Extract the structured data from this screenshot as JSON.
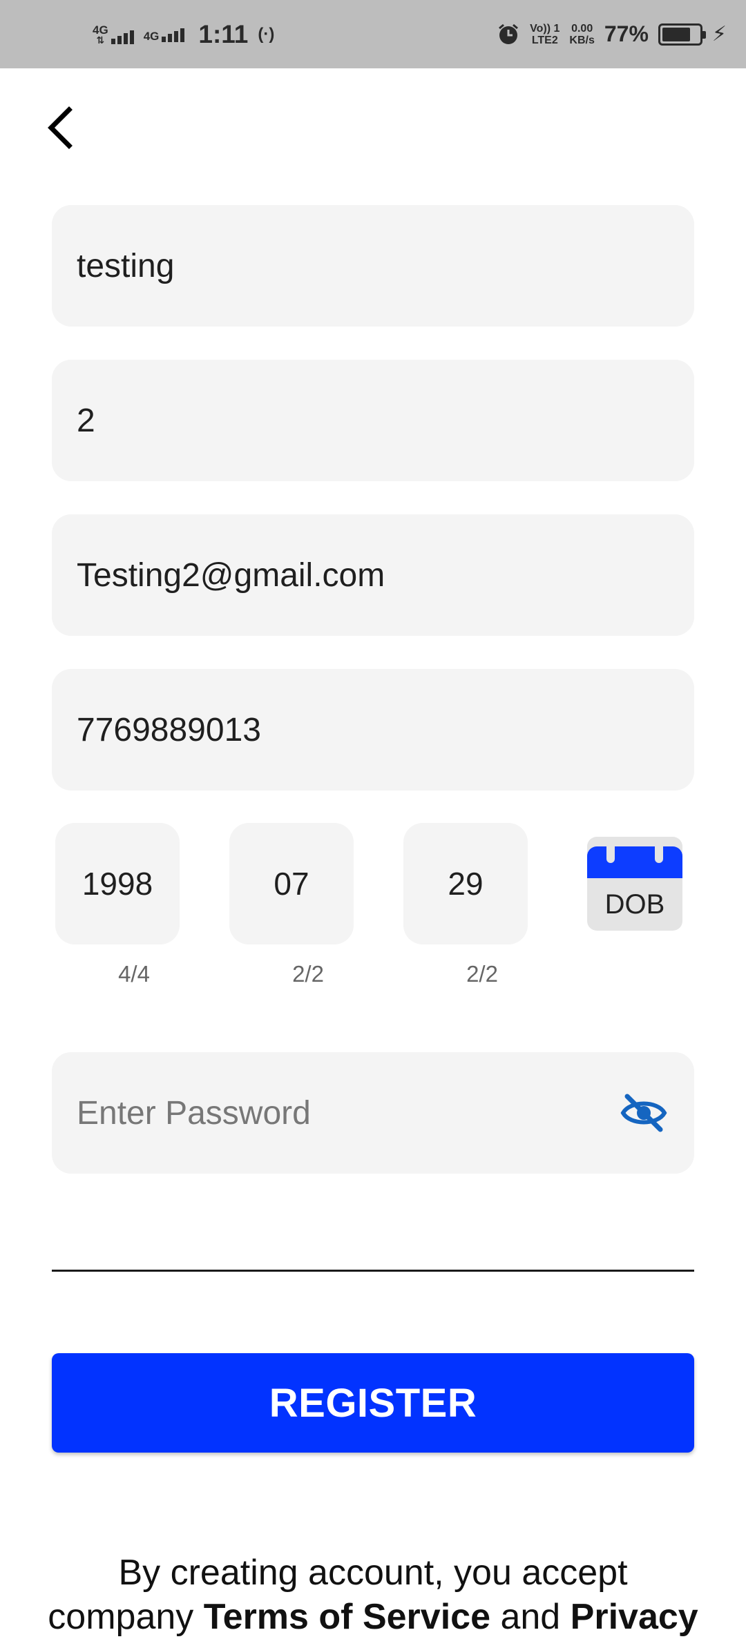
{
  "status_bar": {
    "net1": "4G",
    "net2": "4G",
    "time": "1:11",
    "hotspot": "(·)",
    "volte_line1": "Vo)) 1",
    "volte_line2": "LTE2",
    "speed_value": "0.00",
    "speed_unit": "KB/s",
    "battery_percent": "77%",
    "battery_level": 0.77
  },
  "form": {
    "first_name": "testing",
    "last_name": "2",
    "email": "Testing2@gmail.com",
    "phone": "7769889013",
    "dob": {
      "year": "1998",
      "month": "07",
      "day": "29",
      "year_counter": "4/4",
      "month_counter": "2/2",
      "day_counter": "2/2",
      "calendar_label": "DOB"
    },
    "password_placeholder": "Enter Password"
  },
  "register_label": "REGISTER",
  "terms": {
    "line_prefix": "By creating account, you accept",
    "line2_prefix": "company ",
    "terms_link": "Terms of Service",
    "and": " and ",
    "privacy_link": "Privacy"
  },
  "colors": {
    "accent": "#0233ff",
    "field_bg": "#f4f4f4",
    "statusbar_bg": "#bdbdbd"
  },
  "icons": {
    "back": "chevron-left-icon",
    "calendar": "calendar-icon",
    "password_toggle": "eye-off-icon"
  }
}
